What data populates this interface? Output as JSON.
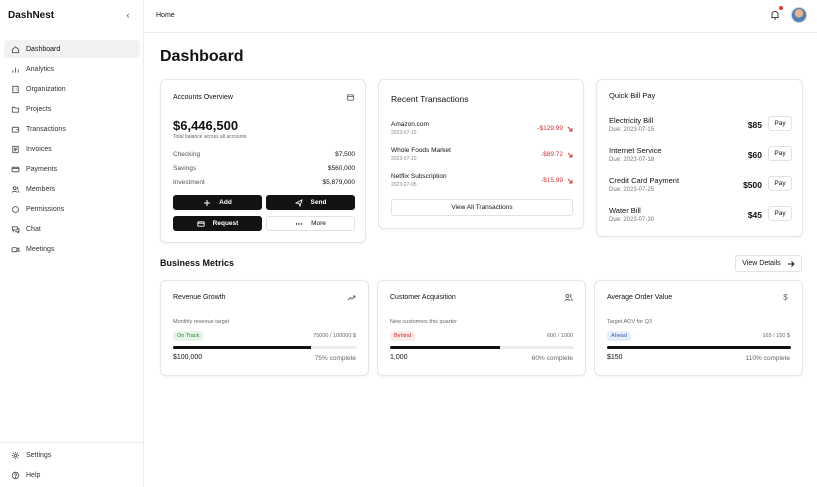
{
  "app": {
    "name": "DashNest"
  },
  "sidebar": {
    "items": [
      {
        "label": "Dashboard",
        "icon": "home-icon",
        "active": true
      },
      {
        "label": "Analytics",
        "icon": "bar-chart-icon"
      },
      {
        "label": "Organization",
        "icon": "building-icon"
      },
      {
        "label": "Projects",
        "icon": "folder-icon"
      },
      {
        "label": "Transactions",
        "icon": "wallet-icon"
      },
      {
        "label": "Invoices",
        "icon": "receipt-icon"
      },
      {
        "label": "Payments",
        "icon": "credit-card-icon"
      },
      {
        "label": "Members",
        "icon": "users-icon"
      },
      {
        "label": "Permissions",
        "icon": "shield-icon"
      },
      {
        "label": "Chat",
        "icon": "chat-icon"
      },
      {
        "label": "Meetings",
        "icon": "video-icon"
      }
    ],
    "bottom": [
      {
        "label": "Settings",
        "icon": "gear-icon"
      },
      {
        "label": "Help",
        "icon": "help-icon"
      }
    ]
  },
  "header": {
    "breadcrumb": "Home"
  },
  "main": {
    "title": "Dashboard"
  },
  "accounts": {
    "title": "Accounts Overview",
    "balance": "$6,446,500",
    "balance_label": "Total balance across all accounts",
    "rows": [
      {
        "label": "Checking",
        "value": "$7,500"
      },
      {
        "label": "Savings",
        "value": "$560,000"
      },
      {
        "label": "Investment",
        "value": "$5,879,000"
      }
    ],
    "buttons": {
      "add": "Add",
      "send": "Send",
      "request": "Request",
      "more": "More"
    }
  },
  "transactions": {
    "title": "Recent Transactions",
    "items": [
      {
        "name": "Amazon.com",
        "date": "2023-07-15",
        "amount": "-$129.99"
      },
      {
        "name": "Whole Foods Market",
        "date": "2023-07-10",
        "amount": "-$89.72"
      },
      {
        "name": "Netflix Subscription",
        "date": "2023-07-05",
        "amount": "-$15.99"
      }
    ],
    "view_all": "View All Transactions"
  },
  "bills": {
    "title": "Quick Bill Pay",
    "pay_label": "Pay",
    "items": [
      {
        "name": "Electricity Bill",
        "due": "Due: 2023-07-15",
        "amount": "$85"
      },
      {
        "name": "Internet Service",
        "due": "Due: 2023-07-18",
        "amount": "$60"
      },
      {
        "name": "Credit Card Payment",
        "due": "Due: 2023-07-25",
        "amount": "$500"
      },
      {
        "name": "Water Bill",
        "due": "Due: 2023-07-30",
        "amount": "$45"
      }
    ]
  },
  "metrics": {
    "title": "Business Metrics",
    "view_details": "View Details",
    "cards": [
      {
        "title": "Revenue Growth",
        "icon": "trend-up-icon",
        "subtitle": "Monthly revenue target",
        "status": "On Track",
        "status_color": "#2e7d32",
        "target": "75000 / 100000 $",
        "value": "$100,000",
        "percent_text": "75% complete",
        "progress": 0.75
      },
      {
        "title": "Customer Acquisition",
        "icon": "users-icon",
        "subtitle": "New customers this quarter",
        "status": "Behind",
        "status_color": "#c62828",
        "target": "600 / 1000",
        "value": "1,000",
        "percent_text": "60% complete",
        "progress": 0.6
      },
      {
        "title": "Average Order Value",
        "icon": "dollar-icon",
        "subtitle": "Target AOV for Q3",
        "status": "Ahead",
        "status_color": "#2f5fb3",
        "target": "165 / 150 $",
        "value": "$150",
        "percent_text": "110% complete",
        "progress": 1.0
      }
    ]
  }
}
